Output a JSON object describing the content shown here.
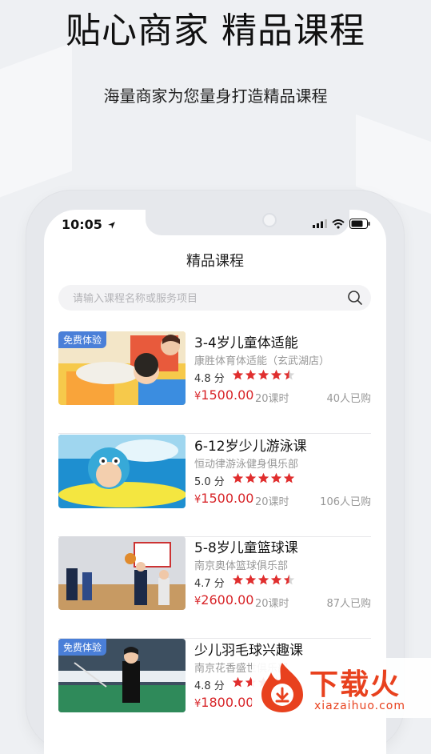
{
  "promo": {
    "headline": "贴心商家 精品课程",
    "subline": "海量商家为您量身打造精品课程"
  },
  "status_bar": {
    "time": "10:05"
  },
  "nav": {
    "title": "精品课程"
  },
  "search": {
    "placeholder": "请输入课程名称或服务项目"
  },
  "colors": {
    "price": "#d8262a",
    "badge": "#4a7fd8",
    "star": "#e02e2e"
  },
  "courses": [
    {
      "badge": "免费体验",
      "title": "3-4岁儿童体适能",
      "shop": "康胜体育体适能（玄武湖店）",
      "score": "4.8 分",
      "rating": 4.5,
      "price_symbol": "¥",
      "price": "1500.00",
      "lessons": "20课时",
      "sold": "40人已购"
    },
    {
      "badge": "",
      "title": "6-12岁少儿游泳课",
      "shop": "恒动律游泳健身俱乐部",
      "score": "5.0 分",
      "rating": 5,
      "price_symbol": "¥",
      "price": "1500.00",
      "lessons": "20课时",
      "sold": "106人已购"
    },
    {
      "badge": "",
      "title": "5-8岁儿童篮球课",
      "shop": "南京奥体篮球俱乐部",
      "score": "4.7 分",
      "rating": 4.5,
      "price_symbol": "¥",
      "price": "2600.00",
      "lessons": "20课时",
      "sold": "87人已购"
    },
    {
      "badge": "免费体验",
      "title": "少儿羽毛球兴趣课",
      "shop": "南京花香盛世俱乐部",
      "score": "4.8 分",
      "rating": 4.5,
      "price_symbol": "¥",
      "price": "1800.00",
      "lessons": "",
      "sold": ""
    }
  ],
  "watermark": {
    "text": "下载火",
    "sub": "xiazaihuo.com"
  }
}
